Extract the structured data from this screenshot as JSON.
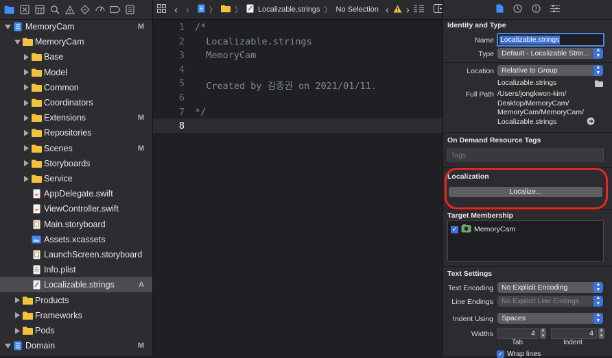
{
  "navigator": {
    "items": [
      {
        "label": "MemoryCam",
        "badge": "M",
        "kind": "project",
        "indent": 0,
        "open": true,
        "selected": false
      },
      {
        "label": "MemoryCam",
        "badge": "",
        "kind": "folder",
        "indent": 1,
        "open": true,
        "selected": false
      },
      {
        "label": "Base",
        "badge": "",
        "kind": "folder",
        "indent": 2,
        "open": false,
        "selected": false
      },
      {
        "label": "Model",
        "badge": "",
        "kind": "folder",
        "indent": 2,
        "open": false,
        "selected": false
      },
      {
        "label": "Common",
        "badge": "",
        "kind": "folder",
        "indent": 2,
        "open": false,
        "selected": false
      },
      {
        "label": "Coordinators",
        "badge": "",
        "kind": "folder",
        "indent": 2,
        "open": false,
        "selected": false
      },
      {
        "label": "Extensions",
        "badge": "M",
        "kind": "folder",
        "indent": 2,
        "open": false,
        "selected": false
      },
      {
        "label": "Repositories",
        "badge": "",
        "kind": "folder",
        "indent": 2,
        "open": false,
        "selected": false
      },
      {
        "label": "Scenes",
        "badge": "M",
        "kind": "folder",
        "indent": 2,
        "open": false,
        "selected": false
      },
      {
        "label": "Storyboards",
        "badge": "",
        "kind": "folder",
        "indent": 2,
        "open": false,
        "selected": false
      },
      {
        "label": "Service",
        "badge": "",
        "kind": "folder",
        "indent": 2,
        "open": false,
        "selected": false
      },
      {
        "label": "AppDelegate.swift",
        "badge": "",
        "kind": "swift",
        "indent": 2,
        "selected": false
      },
      {
        "label": "ViewController.swift",
        "badge": "",
        "kind": "swift",
        "indent": 2,
        "selected": false
      },
      {
        "label": "Main.storyboard",
        "badge": "",
        "kind": "storyboard",
        "indent": 2,
        "selected": false
      },
      {
        "label": "Assets.xcassets",
        "badge": "",
        "kind": "assets",
        "indent": 2,
        "selected": false
      },
      {
        "label": "LaunchScreen.storyboard",
        "badge": "",
        "kind": "storyboard",
        "indent": 2,
        "selected": false
      },
      {
        "label": "Info.plist",
        "badge": "",
        "kind": "plist",
        "indent": 2,
        "selected": false
      },
      {
        "label": "Localizable.strings",
        "badge": "A",
        "kind": "strings",
        "indent": 2,
        "selected": true
      },
      {
        "label": "Products",
        "badge": "",
        "kind": "folder",
        "indent": 1,
        "open": false,
        "selected": false
      },
      {
        "label": "Frameworks",
        "badge": "",
        "kind": "folder",
        "indent": 1,
        "open": false,
        "selected": false
      },
      {
        "label": "Pods",
        "badge": "",
        "kind": "folder",
        "indent": 1,
        "open": false,
        "selected": false
      },
      {
        "label": "Domain",
        "badge": "M",
        "kind": "project",
        "indent": 0,
        "open": true,
        "selected": false
      }
    ]
  },
  "jumpbar": {
    "file": "Localizable.strings",
    "selection": "No Selection"
  },
  "editor": {
    "current_line": 8,
    "lines": [
      {
        "n": "1",
        "text": "/*"
      },
      {
        "n": "2",
        "text": "  Localizable.strings"
      },
      {
        "n": "3",
        "text": "  MemoryCam"
      },
      {
        "n": "4",
        "text": ""
      },
      {
        "n": "5",
        "text": "  Created by 김종권 on 2021/01/11."
      },
      {
        "n": "6",
        "text": ""
      },
      {
        "n": "7",
        "text": "*/"
      },
      {
        "n": "8",
        "text": ""
      }
    ]
  },
  "inspector": {
    "identity": {
      "title": "Identity and Type",
      "name_label": "Name",
      "name_value": "Localizable.strings",
      "type_label": "Type",
      "type_value": "Default - Localizable Strin...",
      "location_label": "Location",
      "location_value": "Relative to Group",
      "location_file": "Localizable.strings",
      "fullpath_label": "Full Path",
      "fullpath_lines": [
        "/Users/jongkwon-kim/",
        "Desktop/MemoryCam/",
        "MemoryCam/MemoryCam/",
        "Localizable.strings"
      ]
    },
    "odr": {
      "title": "On Demand Resource Tags",
      "placeholder": "Tags"
    },
    "localization": {
      "title": "Localization",
      "button": "Localize...",
      "highlight_color": "#e8281c"
    },
    "target": {
      "title": "Target Membership",
      "items": [
        {
          "label": "MemoryCam",
          "checked": true
        }
      ]
    },
    "text_settings": {
      "title": "Text Settings",
      "encoding_label": "Text Encoding",
      "encoding_value": "No Explicit Encoding",
      "endings_label": "Line Endings",
      "endings_value": "No Explicit Line Endings",
      "indent_label": "Indent Using",
      "indent_value": "Spaces",
      "widths_label": "Widths",
      "tab_value": "4",
      "indent_width_value": "4",
      "tab_caption": "Tab",
      "indent_caption": "Indent",
      "wrap_label": "Wrap lines"
    }
  },
  "colors": {
    "accent": "#3f72d8",
    "folder": "#f3c23c"
  }
}
